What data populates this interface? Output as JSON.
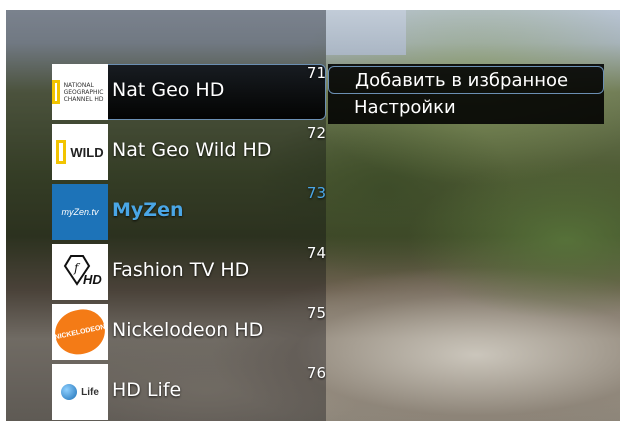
{
  "channels": [
    {
      "number": "71",
      "name": "Nat Geo HD",
      "logo": "national-geographic-channel-logo",
      "logo_text": "NATIONAL GEOGRAPHIC CHANNEL HD",
      "selected": true
    },
    {
      "number": "72",
      "name": "Nat Geo Wild HD",
      "logo": "nat-geo-wild-logo",
      "logo_text": "WILD",
      "selected": false
    },
    {
      "number": "73",
      "name": "MyZen",
      "logo": "myzen-tv-logo",
      "logo_text": "myZen.tv",
      "selected": false,
      "active": true
    },
    {
      "number": "74",
      "name": "Fashion TV HD",
      "logo": "fashion-tv-logo",
      "logo_text": "f HD",
      "selected": false
    },
    {
      "number": "75",
      "name": "Nickelodeon HD",
      "logo": "nickelodeon-logo",
      "logo_text": "NICKELODEON",
      "selected": false
    },
    {
      "number": "76",
      "name": "HD Life",
      "logo": "hd-life-logo",
      "logo_text": "Life",
      "selected": false
    }
  ],
  "context_menu": {
    "items": [
      {
        "label": "Добавить в избранное",
        "highlighted": true
      },
      {
        "label": "Настройки",
        "highlighted": false
      }
    ]
  },
  "colors": {
    "accent": "#4aa6e6",
    "selection_border": "#6b8fb3",
    "nickelodeon_orange": "#f47b16",
    "natgeo_yellow": "#f2c400",
    "myzen_blue": "#1d73b8"
  }
}
